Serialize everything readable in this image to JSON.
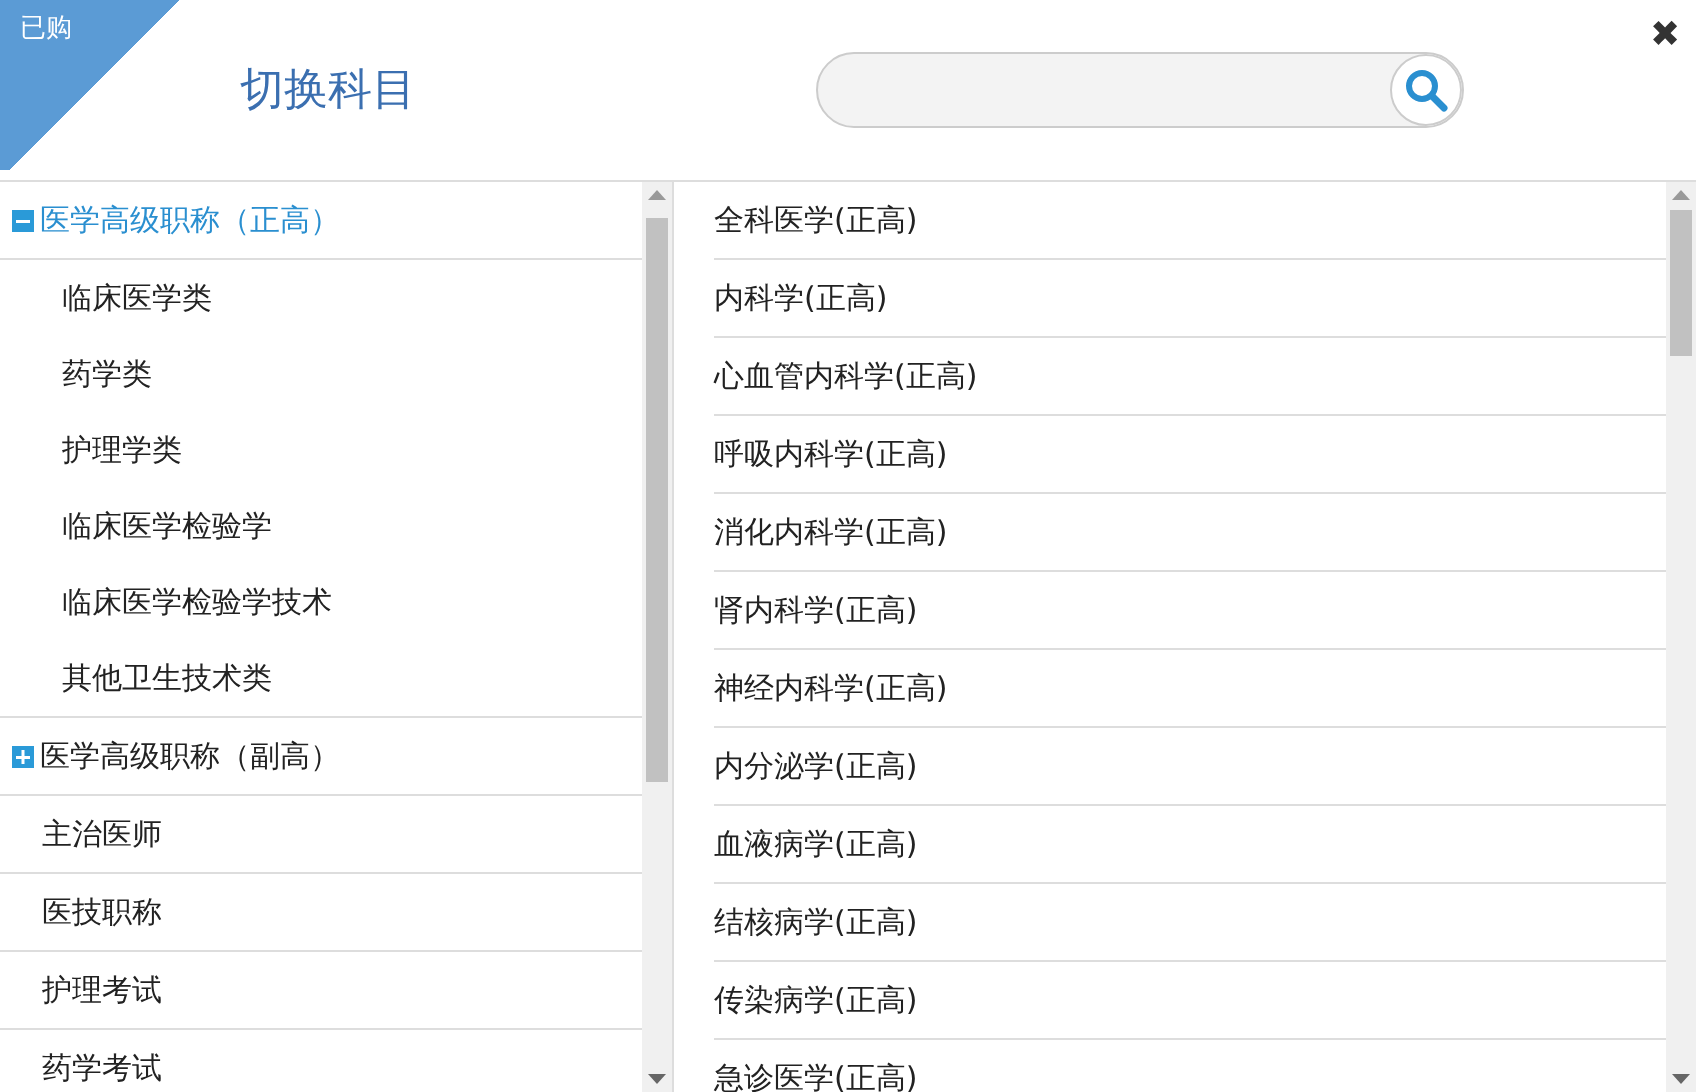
{
  "header": {
    "badge": "已购",
    "title": "切换科目",
    "close": "✖"
  },
  "categories": [
    {
      "label": "医学高级职称（正高）",
      "kind": "group",
      "expanded": true,
      "children": [
        {
          "label": "临床医学类"
        },
        {
          "label": "药学类"
        },
        {
          "label": "护理学类"
        },
        {
          "label": "临床医学检验学"
        },
        {
          "label": "临床医学检验学技术"
        },
        {
          "label": "其他卫生技术类"
        }
      ]
    },
    {
      "label": "医学高级职称（副高）",
      "kind": "group",
      "expanded": false
    },
    {
      "label": "主治医师",
      "kind": "item"
    },
    {
      "label": "医技职称",
      "kind": "item"
    },
    {
      "label": "护理考试",
      "kind": "item"
    },
    {
      "label": "药学考试",
      "kind": "item"
    }
  ],
  "subjects": [
    {
      "label": "全科医学(正高)"
    },
    {
      "label": "内科学(正高)"
    },
    {
      "label": "心血管内科学(正高)"
    },
    {
      "label": "呼吸内科学(正高)"
    },
    {
      "label": "消化内科学(正高)"
    },
    {
      "label": "肾内科学(正高)"
    },
    {
      "label": "神经内科学(正高)"
    },
    {
      "label": "内分泌学(正高)"
    },
    {
      "label": "血液病学(正高)"
    },
    {
      "label": "结核病学(正高)"
    },
    {
      "label": "传染病学(正高)"
    },
    {
      "label": "急诊医学(正高)"
    }
  ]
}
